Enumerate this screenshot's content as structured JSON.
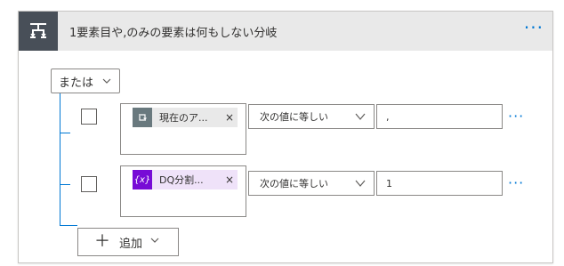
{
  "header": {
    "title": "1要素目や,のみの要素は何もしない分岐",
    "icon": "condition-branch-icon",
    "more_label": "···"
  },
  "group_operator": {
    "value": "または"
  },
  "rows": [
    {
      "token": {
        "label": "現在のア...",
        "icon": "loop-icon",
        "color": "#69797e",
        "remove": "×"
      },
      "operator": "次の値に等しい",
      "value": ",",
      "more": "···"
    },
    {
      "token": {
        "label": "DQ分割...",
        "icon_text": "{x}",
        "color": "#770bd6",
        "bg": "#efe2f9",
        "remove": "×"
      },
      "operator": "次の値に等しい",
      "value": "1",
      "more": "···"
    }
  ],
  "add_button": {
    "plus": "＋",
    "label": "追加"
  },
  "colors": {
    "accent": "#0078d4",
    "header_bg": "#e9e9e9",
    "header_icon_bg": "#484f58"
  }
}
